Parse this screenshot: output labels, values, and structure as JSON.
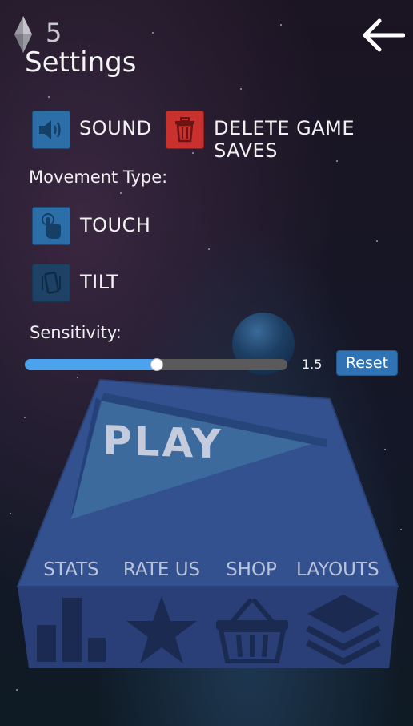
{
  "header": {
    "gem_count": "5",
    "title": "Settings",
    "back_icon": "back-arrow-icon"
  },
  "options": {
    "sound_label": "SOUND",
    "delete_label": "DELETE GAME SAVES",
    "movement_heading": "Movement Type:",
    "touch_label": "TOUCH",
    "tilt_label": "TILT",
    "sensitivity_heading": "Sensitivity:",
    "sensitivity_value": "1.5",
    "sensitivity_fraction": 0.5,
    "reset_label": "Reset"
  },
  "game": {
    "play_label": "PLAY"
  },
  "menu": {
    "stats": "STATS",
    "rate_us": "RATE US",
    "shop": "SHOP",
    "layouts": "LAYOUTS"
  },
  "colors": {
    "accent_blue": "#2c6ea8",
    "danger_red": "#c9312f",
    "slider_fill": "#4aa3ee",
    "platform": "#33508f"
  }
}
